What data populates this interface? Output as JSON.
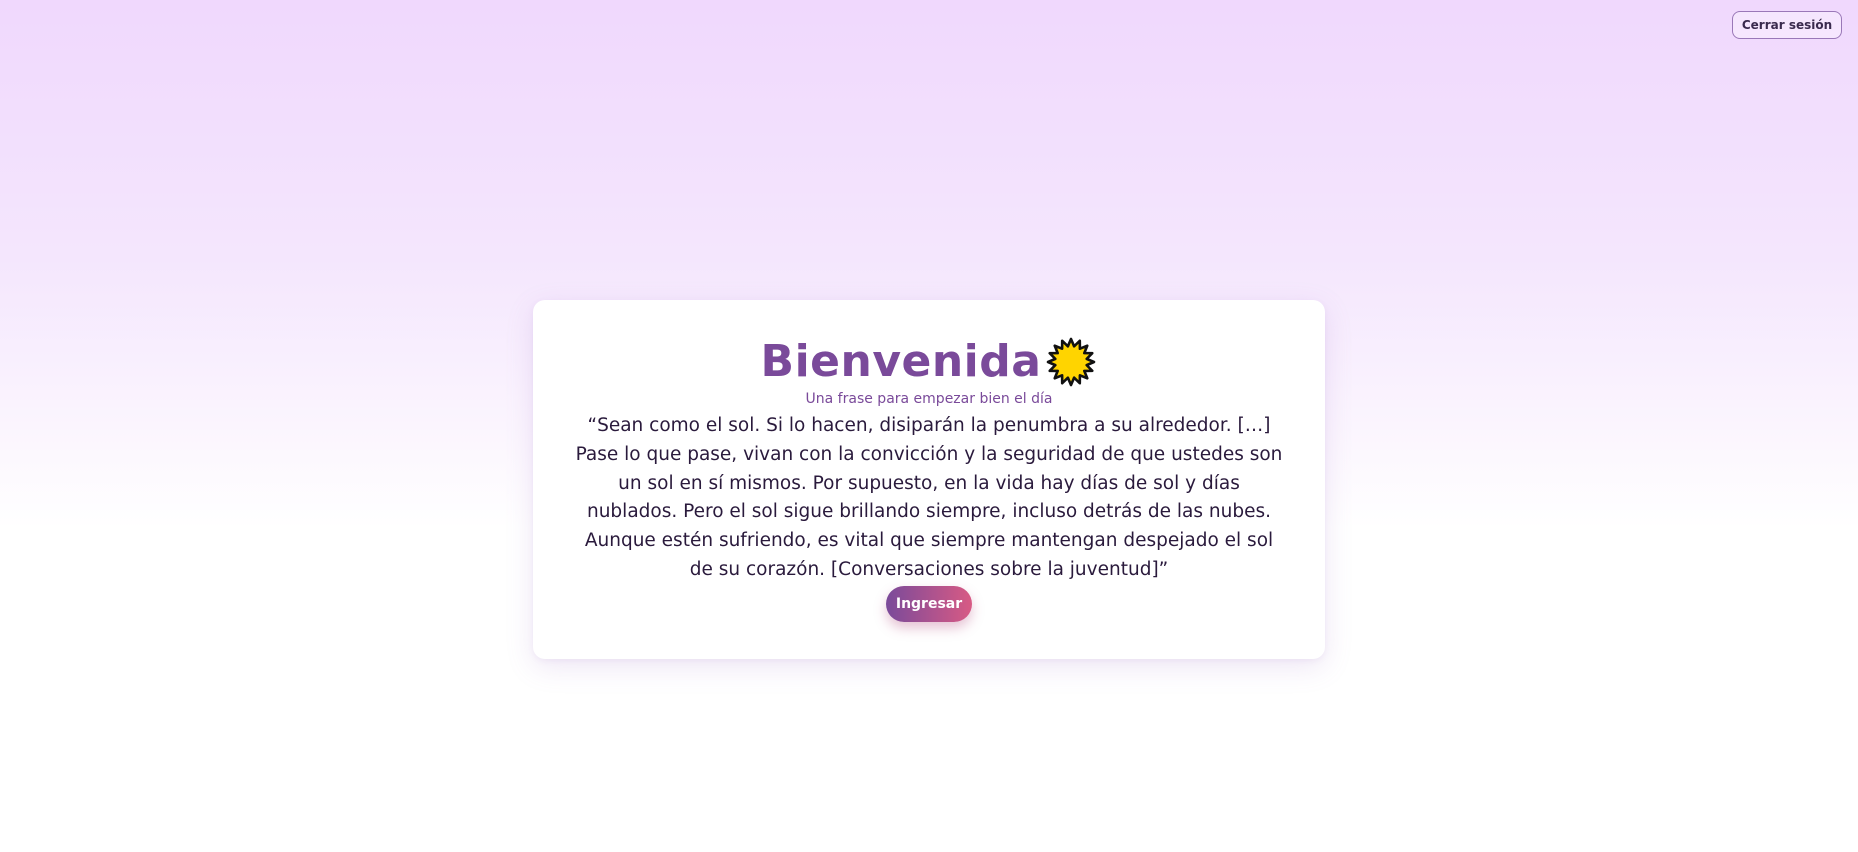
{
  "header": {
    "logout_label": "Cerrar sesión"
  },
  "card": {
    "title": "Bienvenida",
    "title_icon": "sun-icon",
    "subtitle": "Una frase para empezar bien el día",
    "quote": "“Sean como el sol. Si lo hacen, disiparán la penumbra a su alrededor. […] Pase lo que pase, vivan con la convicción y la seguridad de que ustedes son un sol en sí mismos. Por supuesto, en la vida hay días de sol y días nublados. Pero el sol sigue brillando siempre, incluso detrás de las nubes. Aunque estén sufriendo, es vital que siempre mantengan despejado el sol de su corazón. [Conversaciones sobre la juventud]”",
    "enter_label": "Ingresar"
  },
  "colors": {
    "accent": "#7a4a9a",
    "button_gradient_start": "#7a4a9a",
    "button_gradient_end": "#d85a84",
    "sun": "#ffd400"
  }
}
